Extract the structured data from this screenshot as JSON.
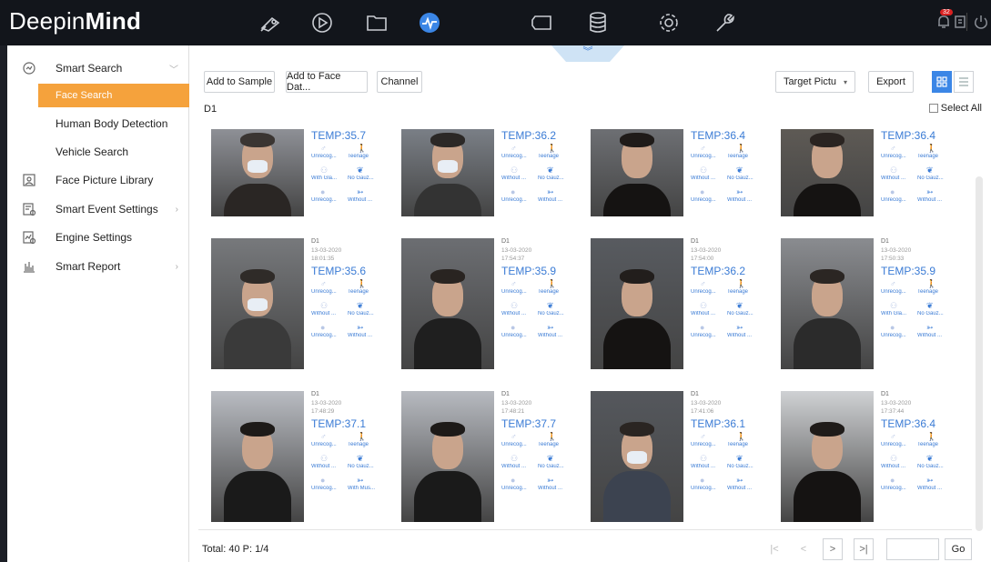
{
  "app": {
    "logo_plain": "Deepin",
    "logo_bold": "Mind"
  },
  "topbar": {
    "icons": [
      "camera-icon",
      "playback-icon",
      "folder-icon",
      "smart-analysis-icon",
      "storage-icon",
      "database-icon",
      "settings-icon",
      "maintenance-icon"
    ],
    "notifications": "32"
  },
  "sidebar": {
    "items": [
      {
        "label": "Smart Search",
        "icon": "smart-search-icon"
      },
      {
        "label": "Face Search"
      },
      {
        "label": "Human Body Detection"
      },
      {
        "label": "Vehicle Search"
      },
      {
        "label": "Face Picture Library",
        "icon": "face-library-icon"
      },
      {
        "label": "Smart Event Settings",
        "icon": "event-settings-icon"
      },
      {
        "label": "Engine Settings",
        "icon": "engine-icon"
      },
      {
        "label": "Smart Report",
        "icon": "report-icon"
      }
    ]
  },
  "toolbar": {
    "add_to_sample": "Add to Sample",
    "add_to_face": "Add to Face Dat...",
    "channel": "Channel",
    "target_picture": "Target Pictu",
    "export": "Export"
  },
  "channel_label": "D1",
  "select_all": "Select All",
  "results": [
    {
      "ch": "",
      "date": "",
      "time": "",
      "temp": "TEMP:35.7",
      "a1": "Unrecog...",
      "a2": "Teenage",
      "b1": "With Gla...",
      "b2": "No Gauz...",
      "c1": "Unrecog...",
      "c2": "Without ..."
    },
    {
      "ch": "",
      "date": "",
      "time": "",
      "temp": "TEMP:36.2",
      "a1": "Unrecog...",
      "a2": "Teenage",
      "b1": "Without ...",
      "b2": "No Gauz...",
      "c1": "Unrecog...",
      "c2": "Without ..."
    },
    {
      "ch": "",
      "date": "",
      "time": "",
      "temp": "TEMP:36.4",
      "a1": "Unrecog...",
      "a2": "Teenage",
      "b1": "Without ...",
      "b2": "No Gauz...",
      "c1": "Unrecog...",
      "c2": "Without ..."
    },
    {
      "ch": "",
      "date": "",
      "time": "",
      "temp": "TEMP:36.4",
      "a1": "Unrecog...",
      "a2": "Teenage",
      "b1": "Without ...",
      "b2": "No Gauz...",
      "c1": "Unrecog...",
      "c2": "Without ..."
    },
    {
      "ch": "D1",
      "date": "13-03-2020",
      "time": "18:01:35",
      "temp": "TEMP:35.6",
      "a1": "Unrecog...",
      "a2": "Teenage",
      "b1": "Without ...",
      "b2": "No Gauz...",
      "c1": "Unrecog...",
      "c2": "Without ..."
    },
    {
      "ch": "D1",
      "date": "13-03-2020",
      "time": "17:54:37",
      "temp": "TEMP:35.9",
      "a1": "Unrecog...",
      "a2": "Teenage",
      "b1": "Without ...",
      "b2": "No Gauz...",
      "c1": "Unrecog...",
      "c2": "Without ..."
    },
    {
      "ch": "D1",
      "date": "13-03-2020",
      "time": "17:54:00",
      "temp": "TEMP:36.2",
      "a1": "Unrecog...",
      "a2": "Teenage",
      "b1": "Without ...",
      "b2": "No Gauz...",
      "c1": "Unrecog...",
      "c2": "Without ..."
    },
    {
      "ch": "D1",
      "date": "13-03-2020",
      "time": "17:50:33",
      "temp": "TEMP:35.9",
      "a1": "Unrecog...",
      "a2": "Teenage",
      "b1": "With Gla...",
      "b2": "No Gauz...",
      "c1": "Unrecog...",
      "c2": "Without ..."
    },
    {
      "ch": "D1",
      "date": "13-03-2020",
      "time": "17:48:29",
      "temp": "TEMP:37.1",
      "a1": "Unrecog...",
      "a2": "Teenage",
      "b1": "Without ...",
      "b2": "No Gauz...",
      "c1": "Unrecog...",
      "c2": "With Mus..."
    },
    {
      "ch": "D1",
      "date": "13-03-2020",
      "time": "17:48:21",
      "temp": "TEMP:37.7",
      "a1": "Unrecog...",
      "a2": "Teenage",
      "b1": "Without ...",
      "b2": "No Gauz...",
      "c1": "Unrecog...",
      "c2": "Without ..."
    },
    {
      "ch": "D1",
      "date": "13-03-2020",
      "time": "17:41:06",
      "temp": "TEMP:36.1",
      "a1": "Unrecog...",
      "a2": "Teenage",
      "b1": "Without ...",
      "b2": "No Gauz...",
      "c1": "Unrecog...",
      "c2": "Without ..."
    },
    {
      "ch": "D1",
      "date": "13-03-2020",
      "time": "17:37:44",
      "temp": "TEMP:36.4",
      "a1": "Unrecog...",
      "a2": "Teenage",
      "b1": "Without ...",
      "b2": "No Gauz...",
      "c1": "Unrecog...",
      "c2": "Without ..."
    }
  ],
  "footer": {
    "total": "Total: 40  P: 1/4",
    "go": "Go"
  },
  "colors": {
    "accent": "#3b86e6",
    "active_menu": "#f5a23c",
    "topbar": "#12151b"
  }
}
